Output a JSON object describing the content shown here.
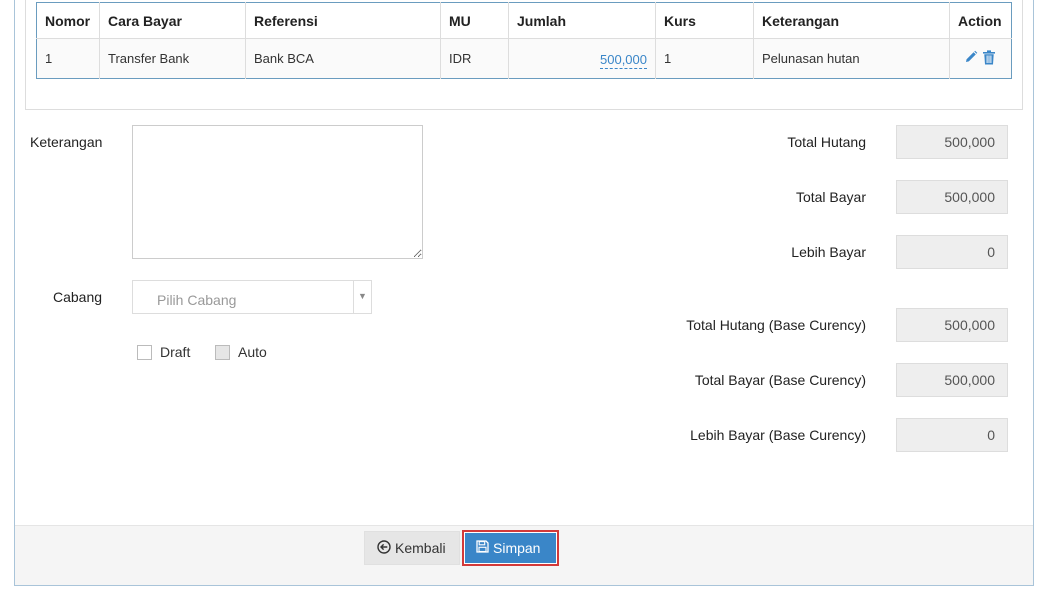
{
  "table": {
    "headers": [
      "Nomor",
      "Cara Bayar",
      "Referensi",
      "MU",
      "Jumlah",
      "Kurs",
      "Keterangan",
      "Action"
    ],
    "rows": [
      {
        "nomor": "1",
        "cara_bayar": "Transfer Bank",
        "referensi": "Bank BCA",
        "mu": "IDR",
        "jumlah": "500,000",
        "kurs": "1",
        "keterangan": "Pelunasan hutan"
      }
    ]
  },
  "form": {
    "keterangan_label": "Keterangan",
    "cabang_label": "Cabang",
    "cabang_placeholder": "Pilih Cabang",
    "draft_label": "Draft",
    "auto_label": "Auto"
  },
  "totals": {
    "total_hutang_label": "Total Hutang",
    "total_hutang": "500,000",
    "total_bayar_label": "Total Bayar",
    "total_bayar": "500,000",
    "lebih_bayar_label": "Lebih Bayar",
    "lebih_bayar": "0",
    "total_hutang_base_label": "Total Hutang (Base Curency)",
    "total_hutang_base": "500,000",
    "total_bayar_base_label": "Total Bayar (Base Curency)",
    "total_bayar_base": "500,000",
    "lebih_bayar_base_label": "Lebih Bayar (Base Curency)",
    "lebih_bayar_base": "0"
  },
  "footer": {
    "back_label": "Kembali",
    "save_label": "Simpan"
  },
  "icons": {
    "edit": "pencil-icon",
    "delete": "trash-icon",
    "back": "arrow-circle-left-icon",
    "save": "floppy-disk-icon"
  },
  "colors": {
    "primary": "#3a86c8",
    "highlight_border": "#d23a3a"
  }
}
